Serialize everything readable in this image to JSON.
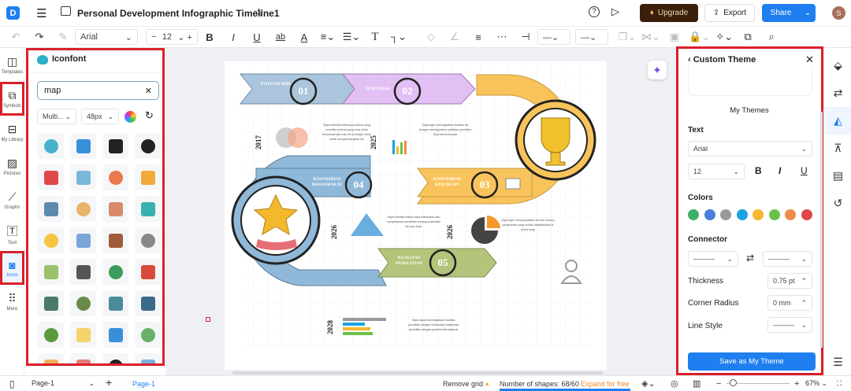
{
  "header": {
    "title": "Personal Development Infographic Timeline1",
    "upgrade": "Upgrade",
    "export": "Export",
    "share": "Share",
    "avatar": "S"
  },
  "toolbar": {
    "font": "Arial",
    "size": "12"
  },
  "rail": [
    {
      "label": "Templates",
      "icon": "template-icon"
    },
    {
      "label": "Symbols",
      "icon": "symbols-icon"
    },
    {
      "label": "My Library",
      "icon": "library-icon"
    },
    {
      "label": "Pictures",
      "icon": "picture-icon"
    },
    {
      "label": "Graphs",
      "icon": "graph-icon"
    },
    {
      "label": "Text",
      "icon": "text-icon"
    },
    {
      "label": "Icons",
      "icon": "icons-icon"
    },
    {
      "label": "More",
      "icon": "more-icon"
    }
  ],
  "panel": {
    "title": "Iconfont",
    "search_value": "map",
    "filter_type": "Multi...",
    "filter_size": "48px"
  },
  "canvas": {
    "steps": [
      {
        "num": "01",
        "label": "POTENSI DIRI"
      },
      {
        "num": "02",
        "label": "DOKTORAL"
      },
      {
        "num": "03",
        "label": "KONTRIBUSI KEILMUAN"
      },
      {
        "num": "04",
        "label": "KONTRIBUSI MASYARAKAT"
      },
      {
        "num": "05",
        "label": "KUALITAS PENELITIAN"
      }
    ],
    "years": [
      "2017",
      "2025",
      "2026",
      "2026",
      "2028"
    ],
    "notes": [
      "Saya memiliki beberapa potensi yang memiliki motivasi yang kuat untuk berinovasi dan mau terus belajar untuk selalu mengembangkan diri",
      "Saya ingin meningkatkan kualitas diri dengan meningkatkan publikasi penelitian di jurnal bereputasi",
      "Saya memiliki tekad untuk membantu dan menyebarkan penelitian tentang kesehatan ibu dan anak",
      "Saya ingin menyampaikan ide dan konsep penyuluhan yang mudah diaplikasikan di dunia kerja",
      "Saya dapat meningkatkan kualitas penelitian dengan melakukan kolaborasi penelitian dengan peneliti internasional"
    ]
  },
  "right": {
    "title": "Custom Theme",
    "my_themes": "My Themes",
    "text_label": "Text",
    "font": "Arial",
    "size": "12",
    "colors_label": "Colors",
    "colors": [
      "#3dae6a",
      "#4a7fd9",
      "#9a9a9a",
      "#1aa3e0",
      "#f5b82e",
      "#6cc04a",
      "#f08a4b",
      "#e04848"
    ],
    "connector_label": "Connector",
    "thickness_label": "Thickness",
    "thickness": "0.75 pt",
    "corner_label": "Corner Radius",
    "corner": "0 mm",
    "line_style_label": "Line Style",
    "save": "Save as My Theme"
  },
  "bottom": {
    "page_select": "Page-1",
    "page_tab": "Page-1",
    "remove_grid": "Remove grid",
    "shapes": "Number of shapes: 68/60",
    "expand": "Expand for free",
    "zoom": "67%"
  }
}
